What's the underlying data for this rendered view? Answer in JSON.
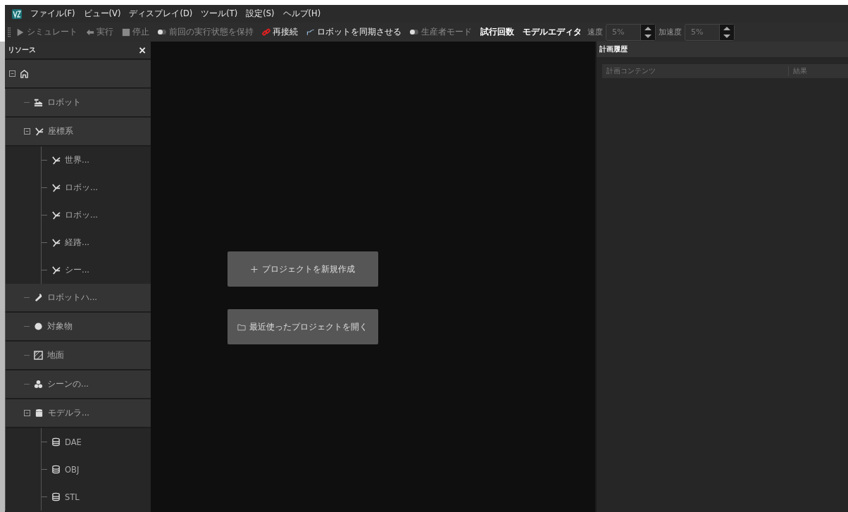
{
  "menu": [
    "ファイル(F)",
    "ビュー(V)",
    "ディスプレイ(D)",
    "ツール(T)",
    "設定(S)",
    "ヘルプ(H)"
  ],
  "toolbar": [
    {
      "kind": "button",
      "label": "シミュレート",
      "disabled": true
    },
    {
      "kind": "button",
      "label": "実行",
      "disabled": true
    },
    {
      "kind": "button",
      "label": "停止",
      "disabled": true
    },
    {
      "kind": "toggle",
      "label": "前回の実行状態を保持",
      "on": false,
      "disabled": true
    },
    {
      "kind": "button",
      "label": "再接続",
      "disabled": false
    },
    {
      "kind": "button",
      "label": "ロボットを同期させる",
      "disabled": false
    },
    {
      "kind": "toggle",
      "label": "生産者モード",
      "on": false,
      "disabled": true
    },
    {
      "kind": "button",
      "label": "試行回数",
      "disabled": false
    },
    {
      "kind": "button",
      "label": "モデルエディタ",
      "disabled": false
    },
    {
      "kind": "spinner",
      "label": "速度",
      "value": "5%"
    },
    {
      "kind": "spinner",
      "label": "加速度",
      "value": "5%"
    }
  ],
  "resources": {
    "title": "リソース",
    "close": "×",
    "tree": {
      "expanded": true,
      "children": [
        {
          "label": "ロボット"
        },
        {
          "label": "座標系",
          "expanded": true,
          "children": [
            {
              "label": "世界..."
            },
            {
              "label": "ロボッ..."
            },
            {
              "label": "ロボッ..."
            },
            {
              "label": "経路..."
            },
            {
              "label": "シー..."
            }
          ]
        },
        {
          "label": "ロボットハ..."
        },
        {
          "label": "対象物"
        },
        {
          "label": "地面"
        },
        {
          "label": "シーンの..."
        },
        {
          "label": "モデルラ...",
          "expanded": true,
          "children": [
            {
              "label": "DAE"
            },
            {
              "label": "OBJ"
            },
            {
              "label": "STL"
            }
          ]
        }
      ]
    }
  },
  "center": {
    "buttons": [
      "プロジェクトを新規作成",
      "最近使ったプロジェクトを開く"
    ]
  },
  "plan_history": {
    "title": "計画履歴",
    "columns": [
      "計画コンテンツ",
      "結果"
    ]
  }
}
